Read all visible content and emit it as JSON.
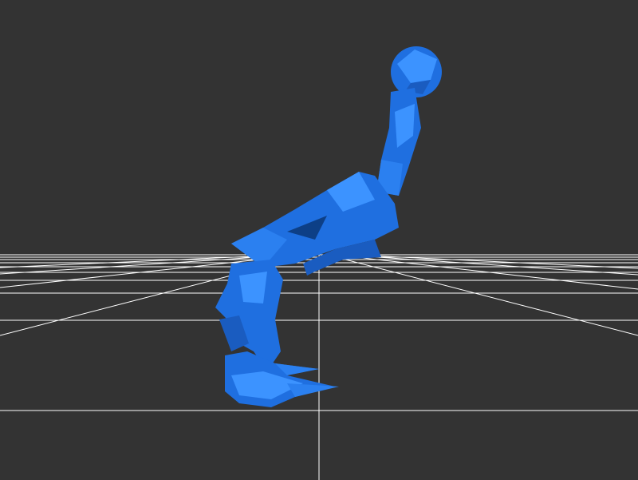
{
  "viewport": {
    "background_color": "#333333"
  },
  "ground_grid": {
    "visible": true,
    "line_color": "#ffffff"
  },
  "model": {
    "color": "#1f6fe0",
    "shade_light": "#3c93ff",
    "shade_dark": "#0d3f86",
    "shade_mid": "#1a5cc0"
  }
}
